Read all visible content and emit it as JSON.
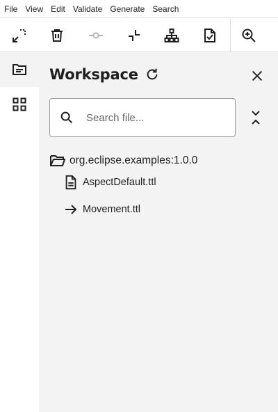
{
  "menu": [
    "File",
    "View",
    "Edit",
    "Validate",
    "Generate",
    "Search"
  ],
  "toolbar": {
    "tools": [
      {
        "name": "expand-layout-icon",
        "enabled": true
      },
      {
        "name": "delete-icon",
        "enabled": true
      },
      {
        "name": "connect-icon",
        "enabled": false
      },
      {
        "name": "collapse-layout-icon",
        "enabled": true
      },
      {
        "name": "hierarchy-icon",
        "enabled": true
      },
      {
        "name": "validate-file-icon",
        "enabled": true
      },
      {
        "name": "zoom-in-icon",
        "enabled": true
      }
    ]
  },
  "rail": {
    "items": [
      {
        "name": "workspace-icon",
        "active": true
      },
      {
        "name": "grid-apps-icon",
        "active": false
      }
    ]
  },
  "panel": {
    "title": "Workspace",
    "search_placeholder": "Search file...",
    "tree": {
      "root": "org.eclipse.examples:1.0.0",
      "files": [
        {
          "label": "AspectDefault.ttl",
          "icon": "file-document-icon"
        },
        {
          "label": "Movement.ttl",
          "icon": "arrow-right-icon"
        }
      ]
    }
  },
  "colors": {
    "panel_bg": "#f3f3f3",
    "icon": "#1f1f1f",
    "disabled_icon": "#b5b5b5"
  }
}
